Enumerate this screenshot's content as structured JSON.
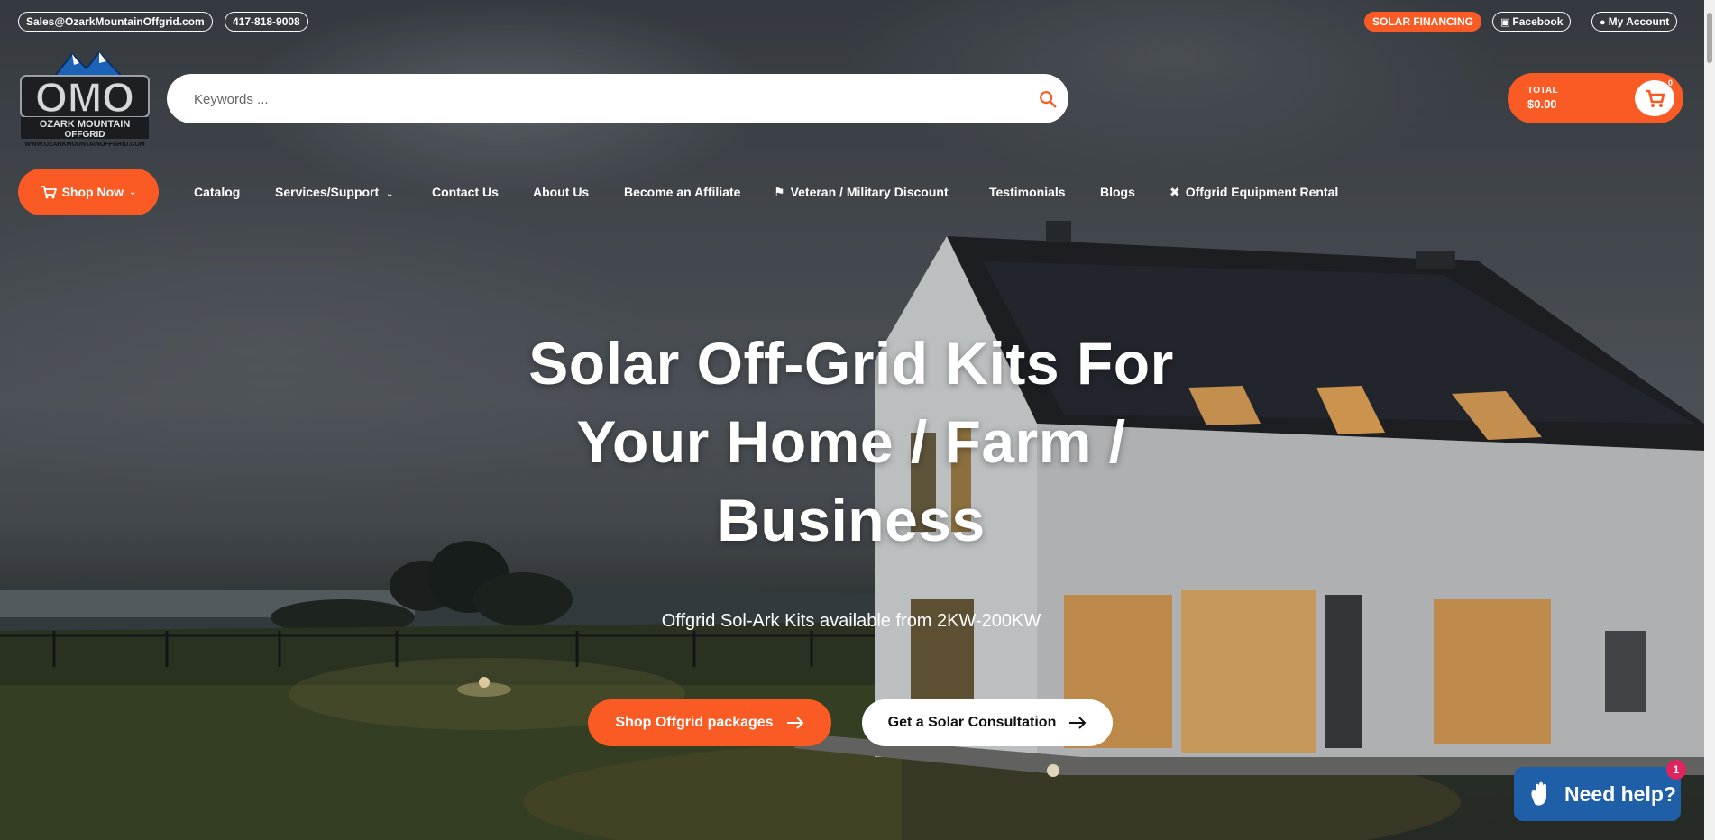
{
  "topbar": {
    "email": "Sales@OzarkMountainOffgrid.com",
    "phone": "417-818-9008",
    "financing": "SOLAR FINANCING",
    "facebook": "Facebook",
    "account": "My Account"
  },
  "logo": {
    "letters": "OMO",
    "line1": "OZARK MOUNTAIN",
    "line2": "OFFGRID",
    "url": "WWW.OZARKMOUNTAINOFFGRID.COM"
  },
  "search": {
    "placeholder": "Keywords ..."
  },
  "cart": {
    "label": "TOTAL",
    "amount": "$0.00",
    "count": "0"
  },
  "nav": {
    "shop_now": "Shop Now",
    "items": [
      "Catalog",
      "Services/Support",
      "Contact Us",
      "About Us",
      "Become an Affiliate",
      "Veteran / Military Discount",
      "Testimonials",
      "Blogs",
      "Offgrid Equipment Rental"
    ]
  },
  "hero": {
    "headline_lines": [
      "Solar Off-Grid Kits For",
      "Your Home / Farm /",
      "Business"
    ],
    "subheading": "Offgrid Sol-Ark Kits available from 2KW-200KW",
    "cta_primary": "Shop Offgrid packages",
    "cta_secondary": "Get a Solar Consultation"
  },
  "help_widget": {
    "label": "Need help?",
    "badge": "1"
  },
  "colors": {
    "accent": "#fa5a24",
    "help_blue": "#1f5fa8",
    "badge": "#e0245e"
  }
}
